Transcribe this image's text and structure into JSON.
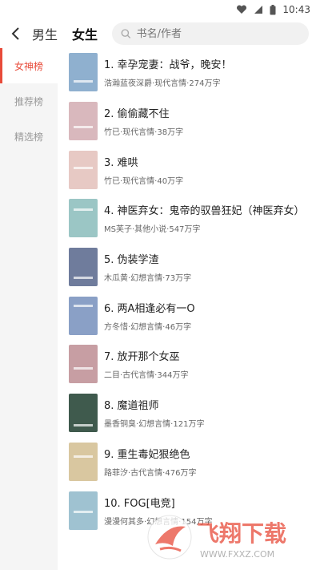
{
  "status_bar": {
    "time": "10:43",
    "icons": [
      "heart-icon",
      "signal-icon",
      "battery-icon"
    ]
  },
  "header": {
    "back_icon": "chevron-left-icon",
    "tabs": [
      {
        "label": "男生",
        "active": false
      },
      {
        "label": "女生",
        "active": true
      }
    ],
    "search": {
      "placeholder": "书名/作者",
      "icon": "search-icon"
    }
  },
  "sidebar": {
    "items": [
      {
        "label": "女神榜",
        "active": true
      },
      {
        "label": "推荐榜",
        "active": false
      },
      {
        "label": "精选榜",
        "active": false
      }
    ]
  },
  "books": [
    {
      "title": "1. 幸孕宠妻：战爷，晚安！",
      "info": "浩瀚蓝夜深爵·现代言情·274万字",
      "cover_color": "#8fb0cf"
    },
    {
      "title": "2. 偷偷藏不住",
      "info": "竹已·现代言情·38万字",
      "cover_color": "#d9b8bd"
    },
    {
      "title": "3. 难哄",
      "info": "竹已·现代言情·40万字",
      "cover_color": "#e7c9c4"
    },
    {
      "title": "4. 神医弃女：鬼帝的驭兽狂妃（神医弃女）",
      "info": "MS芙子·其他小说·547万字",
      "cover_color": "#9bc6c5"
    },
    {
      "title": "5. 伪装学渣",
      "info": "木瓜黄·幻想言情·73万字",
      "cover_color": "#6f7c9c"
    },
    {
      "title": "6. 两A相逢必有一O",
      "info": "方冬惜·幻想言情·46万字",
      "cover_color": "#8aa0c6"
    },
    {
      "title": "7. 放开那个女巫",
      "info": "二目·古代言情·344万字",
      "cover_color": "#c79ea3"
    },
    {
      "title": "8. 魔道祖师",
      "info": "墨香铜臭·幻想言情·121万字",
      "cover_color": "#3f5a4d"
    },
    {
      "title": "9. 重生毒妃狠绝色",
      "info": "路菲汐·古代言情·476万字",
      "cover_color": "#d9c7a0"
    },
    {
      "title": "10. FOG[电竞]",
      "info": "漫漫何其多·幻想言情·154万字",
      "cover_color": "#9fc2d1"
    }
  ],
  "watermark": {
    "text": "飞翔下载",
    "url_text": "WWW.FXXZ.COM"
  }
}
